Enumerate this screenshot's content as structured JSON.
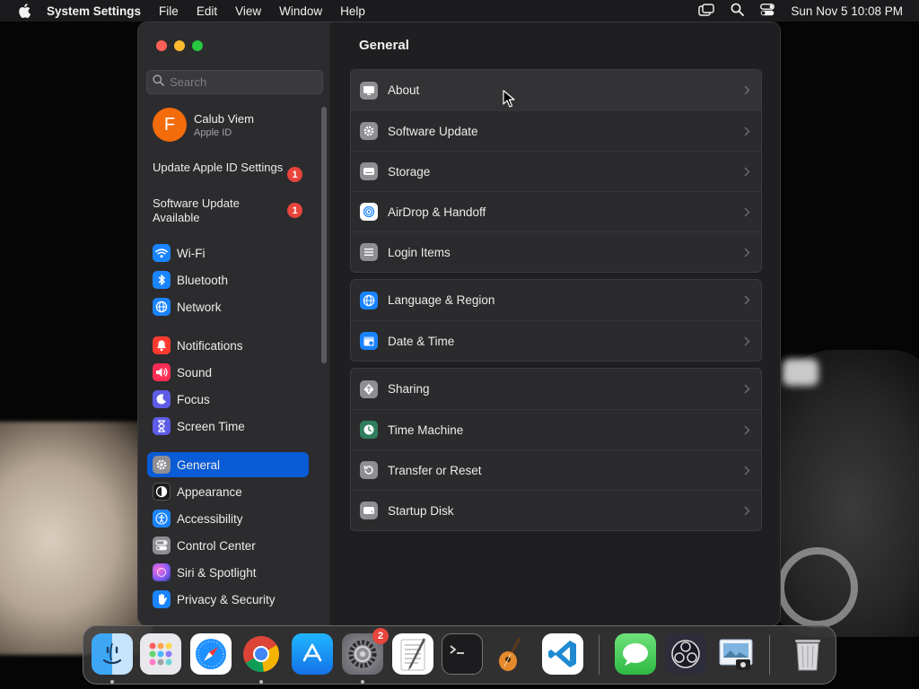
{
  "menubar": {
    "app_name": "System Settings",
    "menus": [
      "File",
      "Edit",
      "View",
      "Window",
      "Help"
    ],
    "clock": "Sun Nov 5  10:08 PM"
  },
  "sidebar": {
    "search_placeholder": "Search",
    "account": {
      "initial": "F",
      "name": "Calub Viem",
      "subtitle": "Apple ID"
    },
    "notices": [
      {
        "label": "Update Apple ID Settings",
        "badge": "1"
      },
      {
        "label": "Software Update Available",
        "badge": "1"
      }
    ],
    "items": [
      {
        "label": "Wi-Fi",
        "icon": "wifi-icon",
        "color": "#1a84ff"
      },
      {
        "label": "Bluetooth",
        "icon": "bluetooth-icon",
        "color": "#1a84ff"
      },
      {
        "label": "Network",
        "icon": "globe-icon",
        "color": "#1a84ff"
      },
      {
        "label": "Notifications",
        "icon": "bell-icon",
        "color": "#ff3b30"
      },
      {
        "label": "Sound",
        "icon": "speaker-icon",
        "color": "#ff2d55"
      },
      {
        "label": "Focus",
        "icon": "moon-icon",
        "color": "#5e5ce6"
      },
      {
        "label": "Screen Time",
        "icon": "hourglass-icon",
        "color": "#5e5ce6"
      },
      {
        "label": "General",
        "icon": "gear-icon",
        "color": "#8e8e93",
        "selected": true
      },
      {
        "label": "Appearance",
        "icon": "appearance-icon",
        "color": "#1c1c1e"
      },
      {
        "label": "Accessibility",
        "icon": "accessibility-icon",
        "color": "#1a84ff"
      },
      {
        "label": "Control Center",
        "icon": "toggles-icon",
        "color": "#8e8e93"
      },
      {
        "label": "Siri & Spotlight",
        "icon": "siri-icon",
        "color": "#c051e0"
      },
      {
        "label": "Privacy & Security",
        "icon": "hand-icon",
        "color": "#1a84ff"
      }
    ]
  },
  "content": {
    "title": "General",
    "groups": [
      [
        {
          "label": "About",
          "icon": "display-icon"
        },
        {
          "label": "Software Update",
          "icon": "gear-icon"
        },
        {
          "label": "Storage",
          "icon": "drive-icon"
        },
        {
          "label": "AirDrop & Handoff",
          "icon": "airdrop-icon"
        },
        {
          "label": "Login Items",
          "icon": "list-icon"
        }
      ],
      [
        {
          "label": "Language & Region",
          "icon": "globe-icon"
        },
        {
          "label": "Date & Time",
          "icon": "calendar-icon"
        }
      ],
      [
        {
          "label": "Sharing",
          "icon": "sharing-icon"
        },
        {
          "label": "Time Machine",
          "icon": "time-machine-icon"
        },
        {
          "label": "Transfer or Reset",
          "icon": "reset-icon"
        },
        {
          "label": "Startup Disk",
          "icon": "disk-icon"
        }
      ]
    ]
  },
  "dock": {
    "apps": [
      {
        "name": "Finder",
        "icon": "finder-icon",
        "running": true
      },
      {
        "name": "Launchpad",
        "icon": "launchpad-icon"
      },
      {
        "name": "Safari",
        "icon": "safari-icon"
      },
      {
        "name": "Chrome",
        "icon": "chrome-icon",
        "running": true
      },
      {
        "name": "App Store",
        "icon": "app-store-icon"
      },
      {
        "name": "System Settings",
        "icon": "settings-icon",
        "running": true,
        "badge": "2"
      },
      {
        "name": "TextEdit",
        "icon": "textedit-icon"
      },
      {
        "name": "Terminal",
        "icon": "terminal-icon"
      },
      {
        "name": "GarageBand",
        "icon": "garageband-icon"
      },
      {
        "name": "Visual Studio Code",
        "icon": "vscode-icon"
      },
      {
        "name": "Messages",
        "icon": "messages-icon"
      },
      {
        "name": "OBS",
        "icon": "obs-icon"
      },
      {
        "name": "Preview",
        "icon": "preview-icon"
      },
      {
        "name": "Trash",
        "icon": "trash-icon"
      }
    ]
  }
}
